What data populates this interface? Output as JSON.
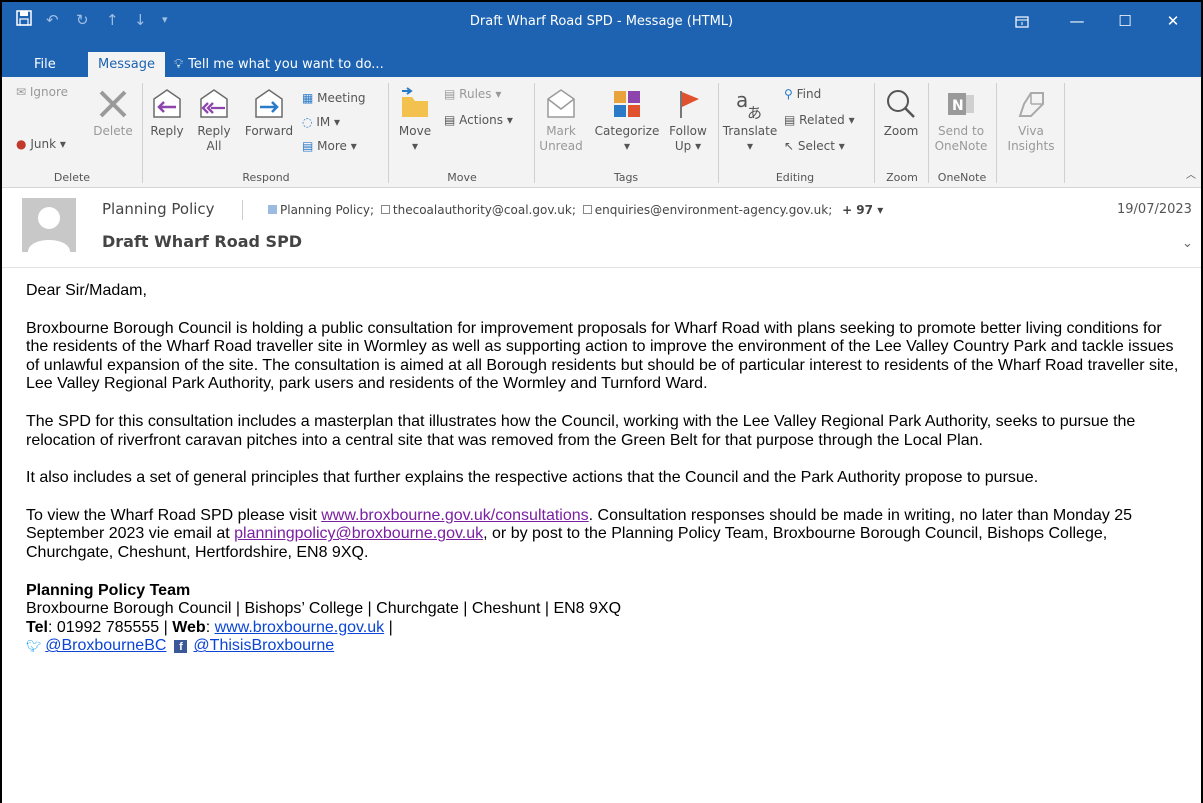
{
  "window": {
    "title": "Draft Wharf Road SPD - Message (HTML)"
  },
  "tabs": {
    "file": "File",
    "message": "Message",
    "tell_me": "Tell me what you want to do..."
  },
  "ribbon": {
    "delete_group": {
      "ignore": "Ignore",
      "junk": "Junk",
      "delete": "Delete",
      "label": "Delete"
    },
    "respond_group": {
      "reply": "Reply",
      "reply_all_1": "Reply",
      "reply_all_2": "All",
      "forward": "Forward",
      "meeting": "Meeting",
      "im": "IM",
      "more": "More",
      "label": "Respond"
    },
    "move_group": {
      "move": "Move",
      "rules": "Rules",
      "actions": "Actions",
      "label": "Move"
    },
    "tags_group": {
      "mark_1": "Mark",
      "mark_2": "Unread",
      "categorize": "Categorize",
      "follow_1": "Follow",
      "follow_2": "Up",
      "label": "Tags"
    },
    "editing_group": {
      "translate": "Translate",
      "find": "Find",
      "related": "Related",
      "select": "Select",
      "label": "Editing"
    },
    "zoom_group": {
      "zoom": "Zoom",
      "label": "Zoom"
    },
    "onenote_group": {
      "send_1": "Send to",
      "send_2": "OneNote",
      "label": "OneNote"
    },
    "viva": {
      "l1": "Viva",
      "l2": "Insights"
    }
  },
  "header": {
    "sender": "Planning Policy",
    "subject": "Draft Wharf Road SPD",
    "date": "19/07/2023",
    "recipients": [
      "Planning Policy;",
      "thecoalauthority@coal.gov.uk;",
      "enquiries@environment-agency.gov.uk;"
    ],
    "more": "+ 97"
  },
  "body": {
    "greeting": "Dear Sir/Madam,",
    "p1": "Broxbourne Borough Council is holding a public consultation for improvement proposals for Wharf Road with plans seeking to promote better living conditions for the residents of the Wharf Road traveller site in Wormley as well as supporting action to improve the environment of the Lee Valley Country Park and tackle issues of unlawful expansion of the site. The consultation is aimed at all Borough residents but should be of particular interest to residents of the Wharf Road traveller site, Lee Valley Regional Park Authority, park users and residents of the Wormley and Turnford Ward.",
    "p2": "The SPD for this consultation includes a masterplan that illustrates how the Council, working with the Lee Valley Regional Park Authority, seeks to pursue the relocation of riverfront caravan pitches into a central site that was removed from the Green Belt for that purpose through the Local Plan.",
    "p3": "It also includes a set of general principles that further explains the respective actions that the Council and the Park Authority propose to pursue.",
    "p4a": "To view the Wharf Road SPD please visit ",
    "p4link": "www.broxbourne.gov.uk/consultations",
    "p4b": ". Consultation responses should be made in writing, no later than Monday 25 September 2023 vie email at ",
    "p4email": "planningpolicy@broxbourne.gov.uk",
    "p4c": ", or by post to the Planning Policy Team, Broxbourne Borough Council, Bishops College, Churchgate, Cheshunt, Hertfordshire, EN8 9XQ.",
    "sig_team": "Planning Policy Team",
    "sig_address": "Broxbourne Borough Council | Bishops’ College | Churchgate | Cheshunt | EN8 9XQ",
    "tel_label": "Tel",
    "tel_value": ": 01992 785555 | ",
    "web_label": "Web",
    "web_sep": ": ",
    "web_link": "www.broxbourne.gov.uk",
    "web_end": " |",
    "twitter": "@BroxbourneBC",
    "facebook": "@ThisisBroxbourne"
  }
}
